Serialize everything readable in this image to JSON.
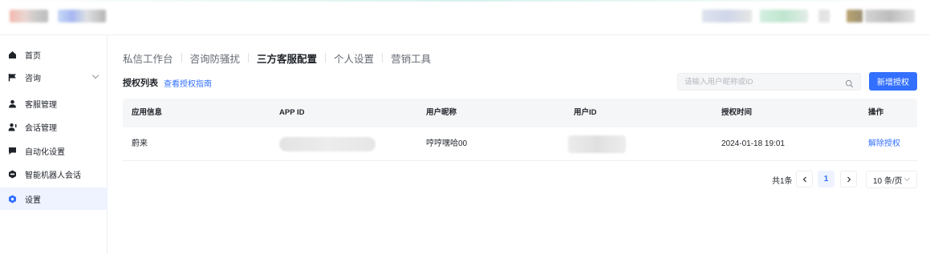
{
  "sidebar": {
    "items": [
      {
        "label": "首页",
        "icon": "home-icon"
      },
      {
        "label": "咨询",
        "icon": "flag-icon"
      },
      {
        "label": "客服管理",
        "icon": "user-icon"
      },
      {
        "label": "会话管理",
        "icon": "user-chat-icon"
      },
      {
        "label": "自动化设置",
        "icon": "message-icon"
      },
      {
        "label": "智能机器人会话",
        "icon": "robot-icon"
      },
      {
        "label": "设置",
        "icon": "gear-icon"
      }
    ]
  },
  "tabs": [
    "私信工作台",
    "咨询防骚扰",
    "三方客服配置",
    "个人设置",
    "营销工具"
  ],
  "section": {
    "title": "授权列表",
    "guide_link": "查看授权指南"
  },
  "search": {
    "placeholder": "请输入用户昵称或ID"
  },
  "new_button": "新增授权",
  "table": {
    "headers": [
      "应用信息",
      "APP ID",
      "用户昵称",
      "用户ID",
      "授权时间",
      "操作"
    ],
    "rows": [
      {
        "app": "蔚来",
        "app_id": "",
        "nickname": "哼哼嘿哈00",
        "user_id": "",
        "time": "2024-01-18 19:01",
        "action": "解除授权"
      }
    ]
  },
  "pagination": {
    "total": "共1条",
    "current_page": "1",
    "page_size": "10 条/页"
  },
  "colors": {
    "accent": "#3370ff",
    "active_bg": "#eef3ff"
  }
}
